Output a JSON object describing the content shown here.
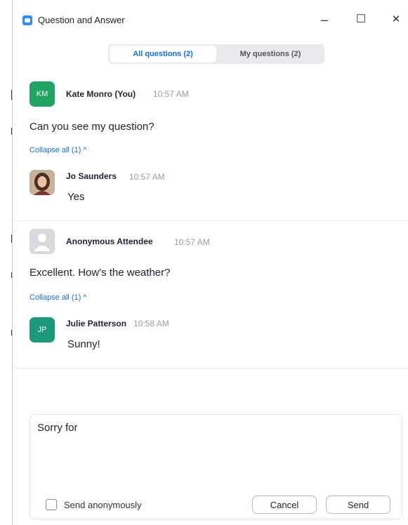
{
  "window": {
    "title": "Question and Answer",
    "minimize_glyph": "–",
    "maximize_glyph": "☐",
    "close_glyph": "✕"
  },
  "tabs": [
    {
      "label": "All questions (2)",
      "active": true
    },
    {
      "label": "My questions (2)",
      "active": false
    }
  ],
  "questions": [
    {
      "author": "Kate Monro (You)",
      "initials": "KM",
      "avatar_color": "#1fa463",
      "time": "10:57 AM",
      "text": "Can you see my question?",
      "collapse_label": "Collapse all (1) ^",
      "reply": {
        "author": "Jo Saunders",
        "time": "10:57 AM",
        "text": "Yes",
        "avatar": "photo"
      }
    },
    {
      "author": "Anonymous Attendee",
      "initials": "",
      "avatar_color": "#d9d9df",
      "time": "10:57 AM",
      "text": "Excellent. How's the weather?",
      "collapse_label": "Collapse all (1) ^",
      "reply": {
        "author": "Julie Patterson",
        "initials": "JP",
        "avatar_color": "#1a9a7a",
        "time": "10:58 AM",
        "text": "Sunny!"
      }
    }
  ],
  "composer": {
    "value": "Sorry for",
    "anonymous_label": "Send anonymously",
    "anonymous_checked": false,
    "cancel_label": "Cancel",
    "send_label": "Send"
  },
  "colors": {
    "accent": "#0e71eb",
    "timestamp": "#9a9aa5"
  }
}
